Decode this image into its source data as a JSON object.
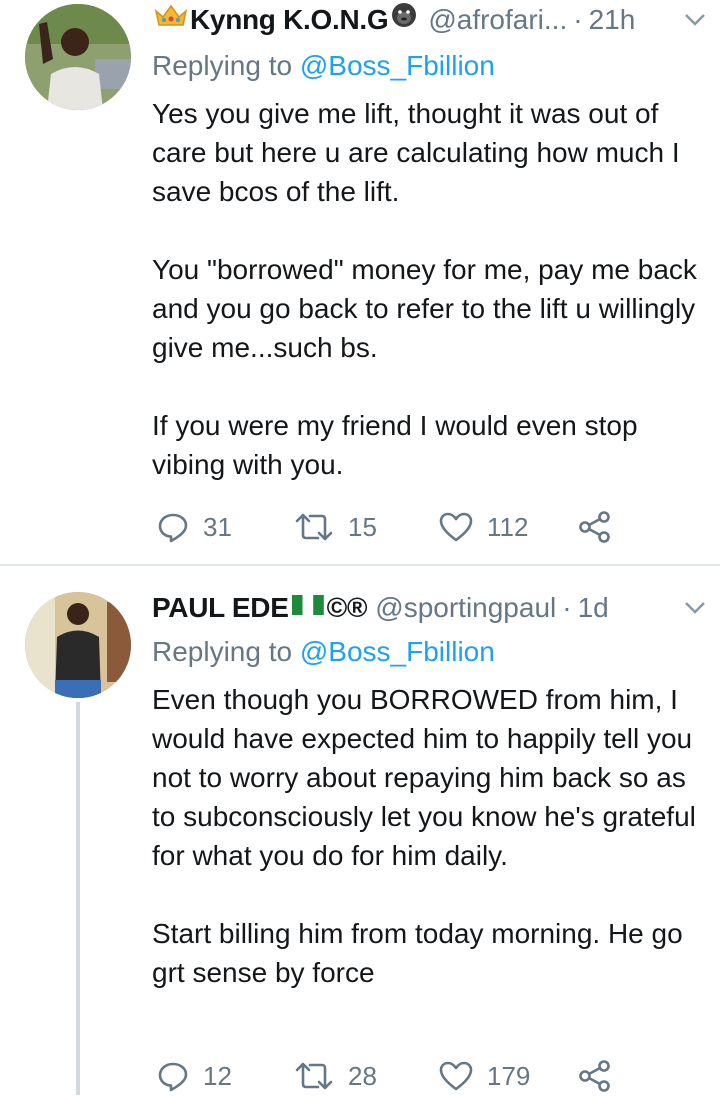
{
  "tweets": [
    {
      "name": "Kynng K.O.N.G",
      "name_prefix_emoji": "crown",
      "name_suffix_emoji": "gorilla",
      "handle": "@afrofari...",
      "time": "21h",
      "replying_label": "Replying to",
      "replying_to": "@Boss_Fbillion",
      "paragraphs": [
        "Yes you give me lift, thought it was out of care but here u are calculating how much I save bcos of the lift.",
        "You \"borrowed\" money for me, pay me back and you go back to refer to the lift u willingly give me...such bs.",
        "If you were my friend I would even stop vibing with you."
      ],
      "replies": "31",
      "retweets": "15",
      "likes": "112"
    },
    {
      "name": "PAUL EDE",
      "name_suffix": "©®",
      "name_flag_emoji": "nigeria-flag",
      "handle": "@sportingpaul",
      "time": "1d",
      "replying_label": "Replying to",
      "replying_to": "@Boss_Fbillion",
      "paragraphs": [
        "Even though you BORROWED from him, I would have expected him to happily tell you not to worry about repaying him back so as to subconsciously let you know he's grateful for what you do for him daily.",
        "Start billing him from today morning. He go grt sense by force"
      ],
      "replies": "12",
      "retweets": "28",
      "likes": "179"
    }
  ],
  "icons": {
    "reply": "reply-icon",
    "retweet": "retweet-icon",
    "like": "heart-icon",
    "share": "share-icon",
    "menu": "chevron-down-icon"
  },
  "colors": {
    "link": "#1da1f2",
    "secondary": "#657786",
    "text": "#14171a",
    "divider": "#e1e8ed"
  }
}
